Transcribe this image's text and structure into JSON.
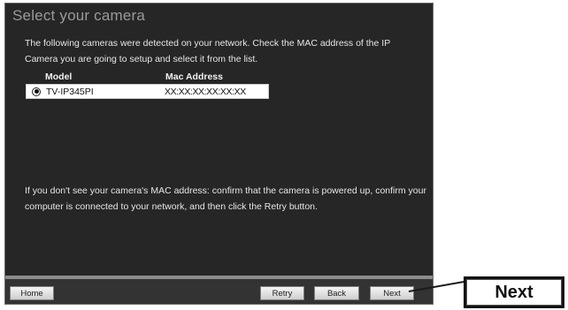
{
  "wizard": {
    "title": "Select your camera",
    "intro": "The following cameras were detected on your network. Check the MAC address of the IP Camera you are going to setup and select it from the list.",
    "table": {
      "headers": {
        "model": "Model",
        "mac": "Mac Address"
      },
      "rows": [
        {
          "model": "TV-IP345PI",
          "mac": "XX:XX:XX:XX:XX:XX",
          "selected": true
        }
      ]
    },
    "hint": "If you don't see your camera's MAC address: confirm that the camera is powered up, confirm your computer is connected to your network, and then click the Retry button."
  },
  "footer": {
    "home_label": "Home",
    "retry_label": "Retry",
    "back_label": "Back",
    "next_label": "Next"
  },
  "callout": {
    "label": "Next"
  },
  "colors": {
    "panel_bg": "#262626",
    "footer_bg": "#333333",
    "title_text": "#9a9a9a",
    "body_text": "#e6e6e6"
  }
}
